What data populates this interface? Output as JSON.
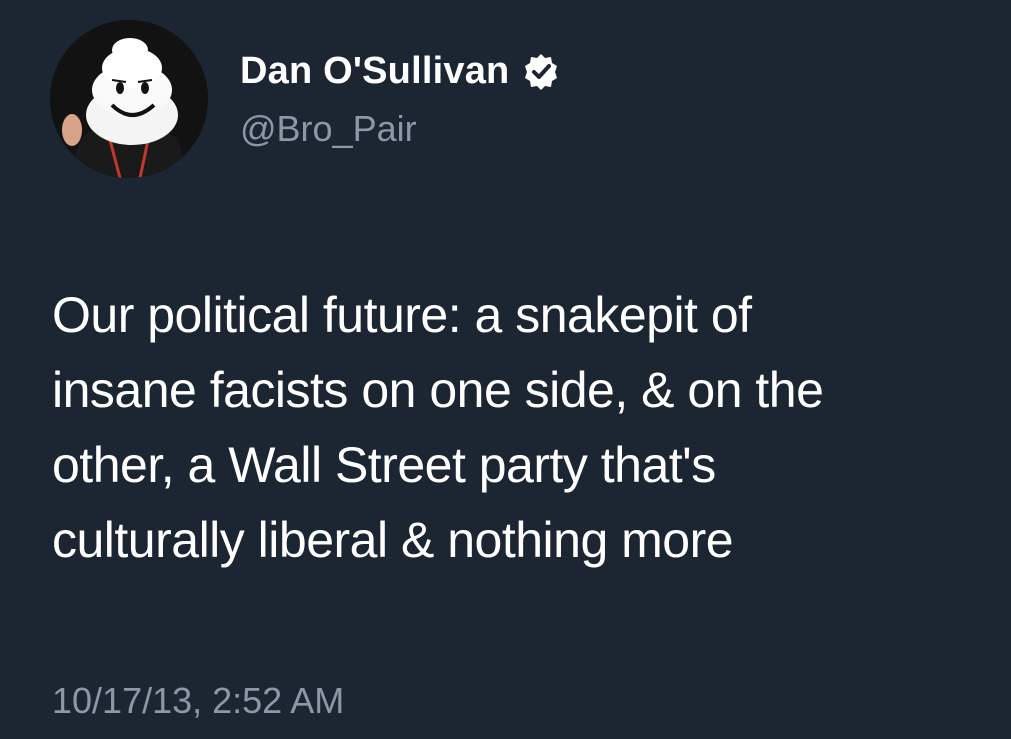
{
  "header": {
    "display_name": "Dan O'Sullivan",
    "handle": "@Bro_Pair",
    "verified_icon": "verified-badge-icon"
  },
  "tweet": {
    "lines": [
      "Our political future: a snakepit of",
      "insane facists on one side, & on the",
      "other, a Wall Street party that's",
      "culturally liberal & nothing more"
    ],
    "timestamp": "10/17/13, 2:52 AM"
  },
  "colors": {
    "background": "#1c2532",
    "primary_text": "#ffffff",
    "secondary_text": "#8b98a5"
  }
}
